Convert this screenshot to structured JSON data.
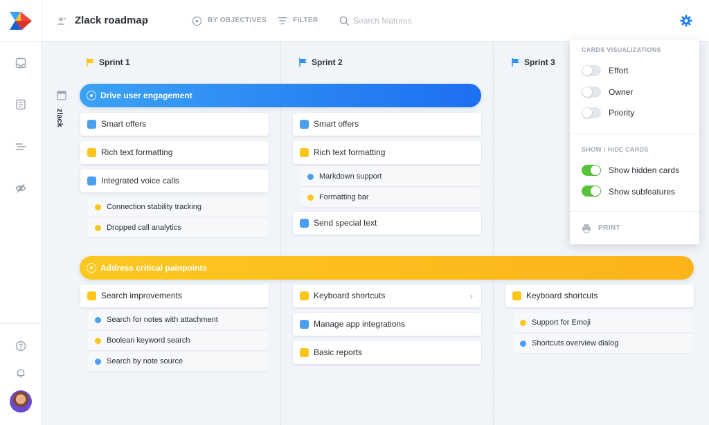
{
  "header": {
    "title": "Zlack roadmap",
    "by_objectives": "BY OBJECTIVES",
    "filter": "FILTER",
    "search_placeholder": "Search features"
  },
  "board": {
    "team": "zlack",
    "sprints": [
      "Sprint 1",
      "Sprint 2",
      "Sprint 3"
    ],
    "objectives": [
      {
        "label": "Drive user engagement",
        "color": "#2f8ff4",
        "columns": [
          [
            {
              "label": "Smart offers",
              "color": "blue",
              "subs": []
            },
            {
              "label": "Rich text formatting",
              "color": "yellow",
              "subs": []
            },
            {
              "label": "Integrated voice calls",
              "color": "blue",
              "subs": [
                {
                  "label": "Connection stability tracking",
                  "color": "yellow"
                },
                {
                  "label": "Dropped call analytics",
                  "color": "yellow"
                }
              ]
            }
          ],
          [
            {
              "label": "Smart offers",
              "color": "blue",
              "subs": []
            },
            {
              "label": "Rich text formatting",
              "color": "yellow",
              "subs": [
                {
                  "label": "Markdown support",
                  "color": "blue"
                },
                {
                  "label": "Formatting bar",
                  "color": "yellow"
                }
              ]
            },
            {
              "label": "Send special text",
              "color": "blue",
              "subs": []
            }
          ]
        ]
      },
      {
        "label": "Address critical painpoints",
        "color": "#fbbd1c",
        "columns": [
          [
            {
              "label": "Search improvements",
              "color": "yellow",
              "subs": [
                {
                  "label": "Search for notes with attachment",
                  "color": "blue"
                },
                {
                  "label": "Boolean keyword search",
                  "color": "yellow"
                },
                {
                  "label": "Search by note source",
                  "color": "blue"
                }
              ]
            }
          ],
          [
            {
              "label": "Keyboard shortcuts",
              "color": "yellow",
              "subs": []
            },
            {
              "label": "Manage app integrations",
              "color": "blue",
              "subs": []
            },
            {
              "label": "Basic reports",
              "color": "yellow",
              "subs": []
            }
          ],
          [
            {
              "label": "Keyboard shortcuts",
              "color": "yellow",
              "subs": [
                {
                  "label": "Support for Emoji",
                  "color": "yellow"
                },
                {
                  "label": "Shortcuts overview dialog",
                  "color": "blue"
                }
              ]
            }
          ]
        ]
      }
    ]
  },
  "popover": {
    "cards_title": "CARDS VISUALIZATIONS",
    "cards_toggles": [
      {
        "label": "Effort",
        "on": false
      },
      {
        "label": "Owner",
        "on": false
      },
      {
        "label": "Priority",
        "on": false
      }
    ],
    "show_title": "SHOW / HIDE CARDS",
    "show_toggles": [
      {
        "label": "Show hidden cards",
        "on": true
      },
      {
        "label": "Show subfeatures",
        "on": true
      }
    ],
    "print": "PRINT"
  },
  "colors": {
    "blue": "#4aa0ef",
    "yellow": "#fbc71d",
    "toggle_on": "#58c23a",
    "settings_accent": "#1d7ff2"
  }
}
